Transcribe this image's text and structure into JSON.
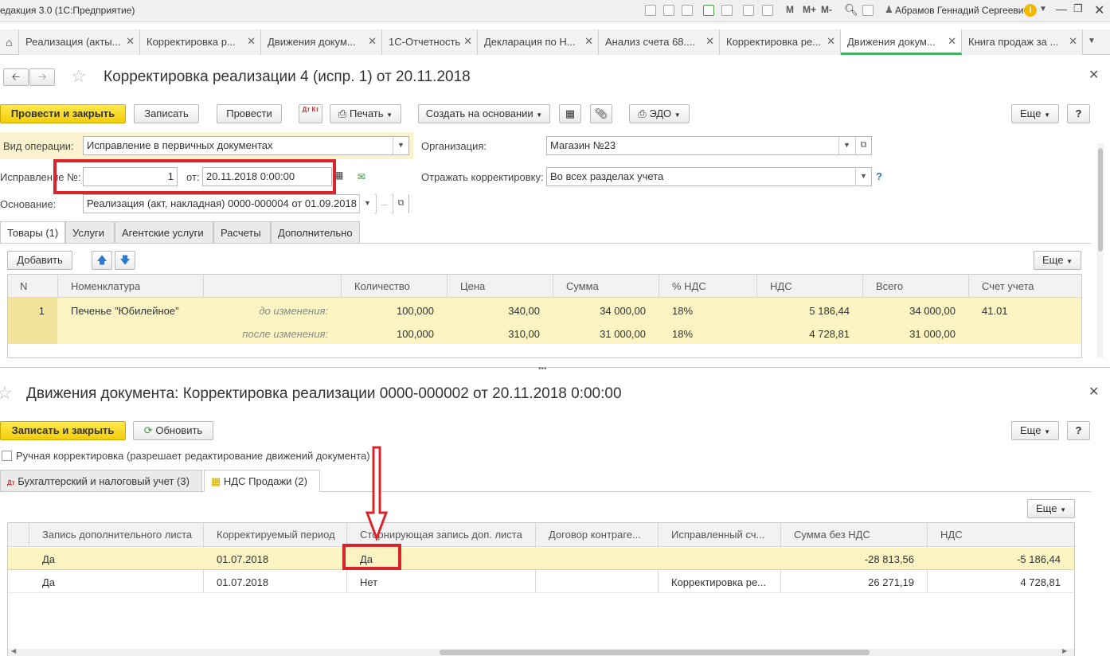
{
  "app_title": "едакция 3.0 (1С:Предприятие)",
  "user_name": "Абрамов Геннадий Сергеевич",
  "toolbar_icons": [
    "save-icon",
    "print-icon",
    "preview-icon",
    "upload-icon",
    "attach-icon",
    "calc-icon",
    "calendar-icon"
  ],
  "memory": {
    "m": "M",
    "mplus": "M+",
    "mminus": "M-"
  },
  "tabs": [
    {
      "label": "Реализация (акты..."
    },
    {
      "label": "Корректировка р..."
    },
    {
      "label": "Движения докум..."
    },
    {
      "label": "1С-Отчетность"
    },
    {
      "label": "Декларация по Н..."
    },
    {
      "label": "Анализ счета 68...."
    },
    {
      "label": "Корректировка ре..."
    },
    {
      "label": "Движения докум..."
    },
    {
      "label": "Книга продаж за ..."
    }
  ],
  "doc1": {
    "title": "Корректировка реализации 4 (испр. 1) от 20.11.2018",
    "buttons": {
      "post_close": "Провести и закрыть",
      "save": "Записать",
      "post": "Провести",
      "dtkt": "Дт Кт",
      "print": "Печать",
      "create_based": "Создать на основании",
      "edo": "ЭДО",
      "more": "Еще",
      "help": "?"
    },
    "op_type_label": "Вид операции:",
    "op_type_value": "Исправление в первичных документах",
    "org_label": "Организация:",
    "org_value": "Магазин №23",
    "fix_label": "Исправление №:",
    "fix_value": "1",
    "from_label": "от:",
    "date_value": "20.11.2018  0:00:00",
    "reflect_label": "Отражать корректировку:",
    "reflect_value": "Во всех разделах учета",
    "reflect_help": "?",
    "basis_label": "Основание:",
    "basis_value": "Реализация (акт, накладная) 0000-000004 от 01.09.2018 1",
    "basis_more": "...",
    "subtabs": [
      "Товары (1)",
      "Услуги",
      "Агентские услуги",
      "Расчеты",
      "Дополнительно"
    ],
    "add_button": "Добавить",
    "more_button": "Еще",
    "columns": [
      "N",
      "Номенклатура",
      "",
      "Количество",
      "Цена",
      "Сумма",
      "% НДС",
      "НДС",
      "Всего",
      "Счет учета"
    ],
    "row": {
      "n": "1",
      "item": "Печенье \"Юбилейное\"",
      "before_label": "до изменения:",
      "after_label": "после изменения:",
      "qty_before": "100,000",
      "price_before": "340,00",
      "sum_before": "34 000,00",
      "vat_rate_before": "18%",
      "vat_before": "5 186,44",
      "total_before": "34 000,00",
      "account": "41.01",
      "qty_after": "100,000",
      "price_after": "310,00",
      "sum_after": "31 000,00",
      "vat_rate_after": "18%",
      "vat_after": "4 728,81",
      "total_after": "31 000,00"
    }
  },
  "splitter": "•••",
  "doc2": {
    "title": "Движения документа: Корректировка реализации 0000-000002 от 20.11.2018 0:00:00",
    "buttons": {
      "save_close": "Записать и закрыть",
      "refresh": "Обновить",
      "more": "Еще",
      "help": "?"
    },
    "manual_label": "Ручная корректировка (разрешает редактирование движений документа)",
    "subtabs": [
      "Бухгалтерский и налоговый учет (3)",
      "НДС Продажи (2)"
    ],
    "more_button": "Еще",
    "columns": [
      "Запись дополнительного листа",
      "Корректируемый период",
      "Сторнирующая запись доп. листа",
      "Договор контраге...",
      "Исправленный сч...",
      "Сумма без НДС",
      "НДС"
    ],
    "rows": [
      {
        "c1": "Да",
        "c2": "01.07.2018",
        "c3": "Да",
        "c4": "",
        "c5": "",
        "c6": "-28 813,56",
        "c7": "-5 186,44"
      },
      {
        "c1": "Да",
        "c2": "01.07.2018",
        "c3": "Нет",
        "c4": "",
        "c5": "Корректировка ре...",
        "c6": "26 271,19",
        "c7": "4 728,81"
      }
    ]
  }
}
